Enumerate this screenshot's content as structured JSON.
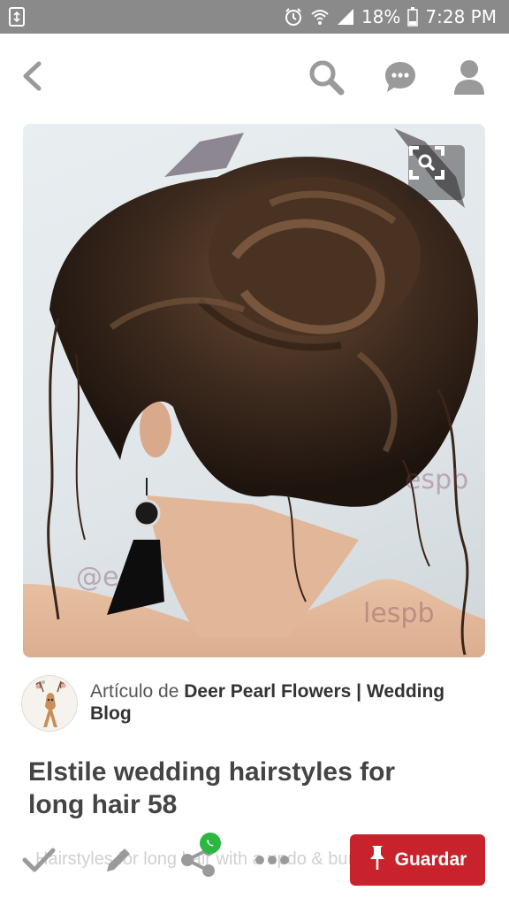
{
  "status_bar": {
    "battery": "18%",
    "time": "7:28 PM",
    "icons": [
      "recycle-icon",
      "alarm-icon",
      "wifi-icon",
      "signal-icon",
      "battery-icon"
    ]
  },
  "nav": {
    "icons": [
      "back-arrow-icon",
      "search-icon",
      "chat-bubble-icon",
      "profile-icon"
    ]
  },
  "pin": {
    "watermarks": [
      "espb",
      "lespb",
      "@e"
    ],
    "visual_search_icon": "visual-search-icon"
  },
  "attribution": {
    "prefix": "Artículo de",
    "source": "Deer Pearl Flowers | Wedding Blog"
  },
  "title": "Elstile wedding hairstyles for long hair 58",
  "actions": {
    "ghost_text": "Hairstyles for long hair with a updo & bun",
    "save_label": "Guardar",
    "icons": [
      "check-icon",
      "pencil-icon",
      "share-icon",
      "whatsapp-icon",
      "more-icon",
      "pin-icon"
    ]
  },
  "colors": {
    "status_bar": "#8a8a8a",
    "icon_gray": "#9a9a9a",
    "save_red": "#c8232c",
    "whatsapp_green": "#2bb741"
  }
}
